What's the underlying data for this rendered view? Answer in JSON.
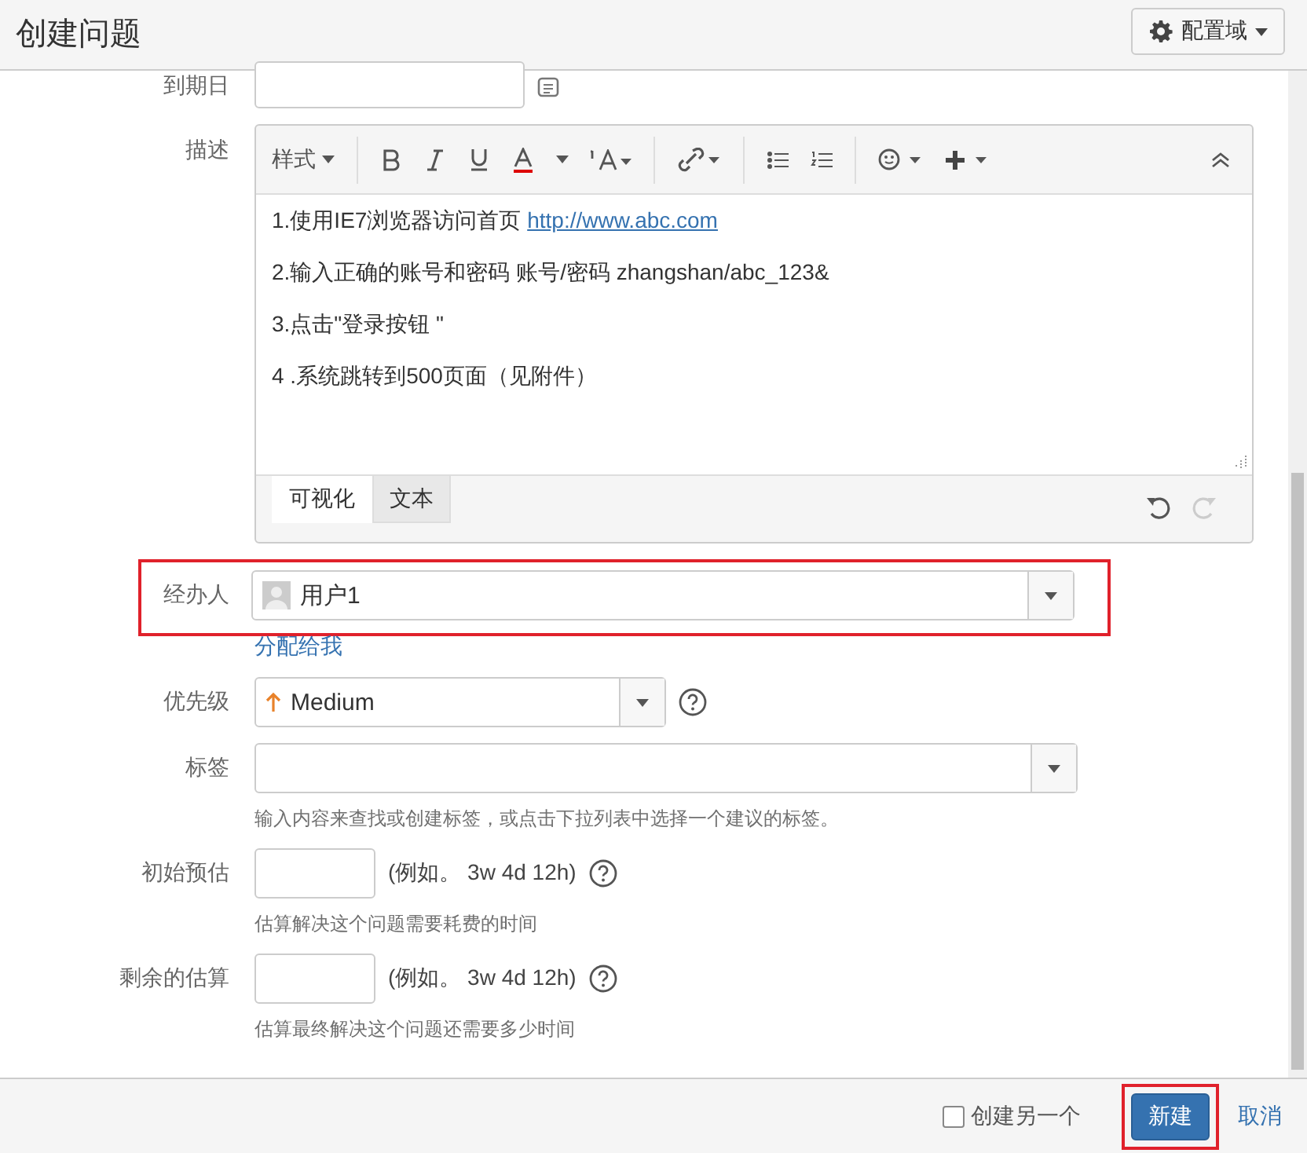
{
  "header": {
    "title": "创建问题",
    "config_button": "配置域"
  },
  "fields": [
    {
      "kind": "date",
      "label": "到期日"
    },
    {
      "kind": "editor",
      "label": "描述",
      "style_menu": "样式",
      "lines": [
        {
          "text": "1.使用IE7浏览器访问首页 ",
          "link": "http://www.abc.com"
        },
        {
          "text": "2.输入正确的账号和密码 账号/密码  zhangshan/abc_123&"
        },
        {
          "text": "3.点击\"登录按钮 \""
        },
        {
          "text": " 4 .系统跳转到500页面（见附件）"
        }
      ],
      "tabs": [
        {
          "label": "可视化",
          "selected": true
        },
        {
          "label": "文本",
          "selected": false
        }
      ]
    },
    {
      "kind": "user",
      "label": "经办人",
      "value": "用户1",
      "link": "分配给我",
      "highlighted": true
    },
    {
      "kind": "priority",
      "label": "优先级",
      "value": "Medium"
    },
    {
      "kind": "labels",
      "label": "标签",
      "hint": "输入内容来查找或创建标签，或点击下拉列表中选择一个建议的标签。"
    },
    {
      "kind": "time",
      "label": "初始预估",
      "example": "(例如。 3w 4d 12h)",
      "hint": "估算解决这个问题需要耗费的时间"
    },
    {
      "kind": "time",
      "label": "剩余的估算",
      "example": "(例如。 3w 4d 12h)",
      "hint": "估算最终解决这个问题还需要多少时间"
    }
  ],
  "footer": {
    "create_another": {
      "label": "创建另一个",
      "checked": false
    },
    "submit": {
      "label": "新建",
      "highlighted": true
    },
    "cancel": "取消"
  }
}
